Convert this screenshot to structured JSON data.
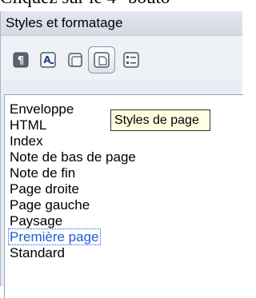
{
  "caption": "Cliquez sur le 4° bouto",
  "window": {
    "title": "Styles et formatage"
  },
  "toolbar": {
    "buttons": [
      {
        "icon": "paragraph-styles-icon",
        "active": false
      },
      {
        "icon": "character-styles-icon",
        "active": false
      },
      {
        "icon": "frame-styles-icon",
        "active": false
      },
      {
        "icon": "page-styles-icon",
        "active": true
      },
      {
        "icon": "list-styles-icon",
        "active": false
      }
    ]
  },
  "tooltip": "Styles de page",
  "styles_list": {
    "items": [
      "Enveloppe",
      "HTML",
      "Index",
      "Note de bas de page",
      "Note de fin",
      "Page droite",
      "Page gauche",
      "Paysage",
      "Première page",
      "Standard"
    ],
    "selected": "Première page"
  },
  "colors": {
    "selection_text": "#1f5bd6",
    "panel_background": "#e8edf4",
    "tooltip_background": "#ffffe1"
  }
}
